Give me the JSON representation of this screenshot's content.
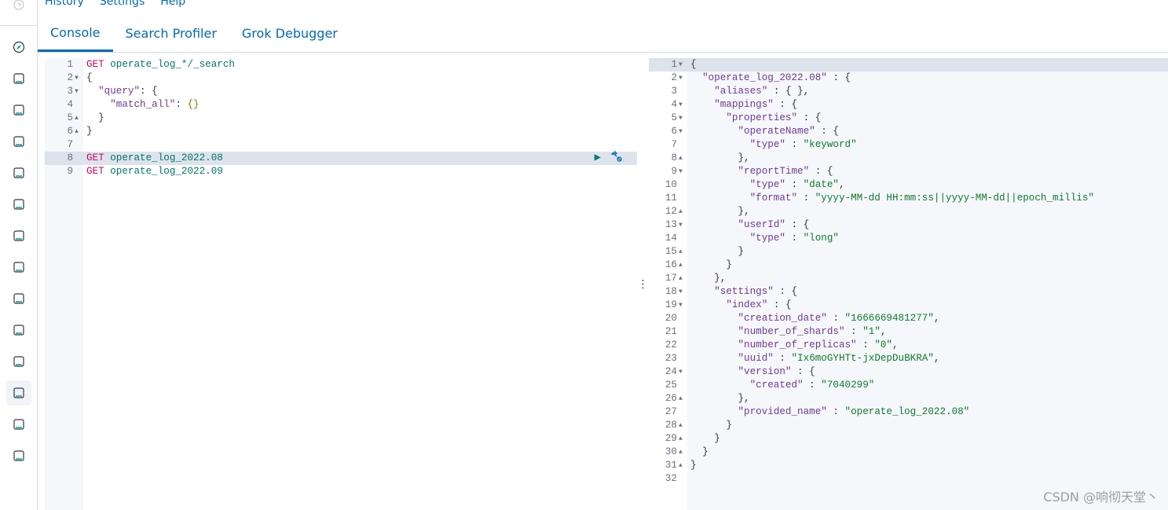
{
  "menu": [
    "History",
    "Settings",
    "Help"
  ],
  "tabs": [
    {
      "label": "Console",
      "active": true
    },
    {
      "label": "Search Profiler"
    },
    {
      "label": "Grok Debugger"
    }
  ],
  "sidebar_icons": [
    "discover-compass-icon",
    "visualize-chart-icon",
    "dashboard-icon",
    "canvas-icon",
    "maps-icon",
    "ml-icon",
    "infrastructure-icon",
    "logs-icon",
    "apm-icon",
    "uptime-icon",
    "security-icon",
    "dev-tools-icon",
    "monitoring-icon",
    "management-gear-icon"
  ],
  "request_editor": {
    "highlighted_line": 8,
    "actions": {
      "run": "▶",
      "wrench": "🔧"
    },
    "lines": [
      {
        "fold": "",
        "tokens": [
          [
            "method",
            "GET"
          ],
          [
            "url",
            " operate_log_*/_search"
          ]
        ]
      },
      {
        "fold": "down",
        "tokens": [
          [
            "punc",
            "{"
          ]
        ]
      },
      {
        "fold": "down",
        "tokens": [
          [
            "punc",
            "  "
          ],
          [
            "key",
            "\"query\""
          ],
          [
            "punc",
            ": {"
          ]
        ]
      },
      {
        "fold": "",
        "tokens": [
          [
            "punc",
            "    "
          ],
          [
            "key",
            "\"match_all\""
          ],
          [
            "punc",
            ": "
          ],
          [
            "brace",
            "{}"
          ]
        ]
      },
      {
        "fold": "up",
        "tokens": [
          [
            "punc",
            "  }"
          ]
        ]
      },
      {
        "fold": "up",
        "tokens": [
          [
            "punc",
            "}"
          ]
        ]
      },
      {
        "fold": "",
        "tokens": []
      },
      {
        "fold": "",
        "tokens": [
          [
            "method",
            "GET"
          ],
          [
            "url",
            " operate_log_2022.08"
          ]
        ]
      },
      {
        "fold": "",
        "tokens": [
          [
            "method",
            "GET"
          ],
          [
            "url",
            " operate_log_2022.09"
          ]
        ]
      }
    ]
  },
  "response_viewer": {
    "highlighted_line": 1,
    "lines": [
      {
        "fold": "down",
        "tokens": [
          [
            "brace",
            "{"
          ]
        ]
      },
      {
        "fold": "down",
        "tokens": [
          [
            "punc",
            "  "
          ],
          [
            "key",
            "\"operate_log_2022.08\""
          ],
          [
            "punc",
            " : {"
          ]
        ]
      },
      {
        "fold": "",
        "tokens": [
          [
            "punc",
            "    "
          ],
          [
            "key",
            "\"aliases\""
          ],
          [
            "punc",
            " : { },"
          ]
        ]
      },
      {
        "fold": "down",
        "tokens": [
          [
            "punc",
            "    "
          ],
          [
            "key",
            "\"mappings\""
          ],
          [
            "punc",
            " : {"
          ]
        ]
      },
      {
        "fold": "down",
        "tokens": [
          [
            "punc",
            "      "
          ],
          [
            "key",
            "\"properties\""
          ],
          [
            "punc",
            " : {"
          ]
        ]
      },
      {
        "fold": "down",
        "tokens": [
          [
            "punc",
            "        "
          ],
          [
            "key",
            "\"operateName\""
          ],
          [
            "punc",
            " : {"
          ]
        ]
      },
      {
        "fold": "",
        "tokens": [
          [
            "punc",
            "          "
          ],
          [
            "key",
            "\"type\""
          ],
          [
            "punc",
            " : "
          ],
          [
            "str",
            "\"keyword\""
          ]
        ]
      },
      {
        "fold": "up",
        "tokens": [
          [
            "punc",
            "        },"
          ]
        ]
      },
      {
        "fold": "down",
        "tokens": [
          [
            "punc",
            "        "
          ],
          [
            "key",
            "\"reportTime\""
          ],
          [
            "punc",
            " : {"
          ]
        ]
      },
      {
        "fold": "",
        "tokens": [
          [
            "punc",
            "          "
          ],
          [
            "key",
            "\"type\""
          ],
          [
            "punc",
            " : "
          ],
          [
            "str",
            "\"date\""
          ],
          [
            "punc",
            ","
          ]
        ]
      },
      {
        "fold": "",
        "tokens": [
          [
            "punc",
            "          "
          ],
          [
            "key",
            "\"format\""
          ],
          [
            "punc",
            " : "
          ],
          [
            "str",
            "\"yyyy-MM-dd HH:mm:ss||yyyy-MM-dd||epoch_millis\""
          ]
        ]
      },
      {
        "fold": "up",
        "tokens": [
          [
            "punc",
            "        },"
          ]
        ]
      },
      {
        "fold": "down",
        "tokens": [
          [
            "punc",
            "        "
          ],
          [
            "key",
            "\"userId\""
          ],
          [
            "punc",
            " : {"
          ]
        ]
      },
      {
        "fold": "",
        "tokens": [
          [
            "punc",
            "          "
          ],
          [
            "key",
            "\"type\""
          ],
          [
            "punc",
            " : "
          ],
          [
            "str",
            "\"long\""
          ]
        ]
      },
      {
        "fold": "up",
        "tokens": [
          [
            "punc",
            "        }"
          ]
        ]
      },
      {
        "fold": "up",
        "tokens": [
          [
            "punc",
            "      }"
          ]
        ]
      },
      {
        "fold": "up",
        "tokens": [
          [
            "punc",
            "    },"
          ]
        ]
      },
      {
        "fold": "down",
        "tokens": [
          [
            "punc",
            "    "
          ],
          [
            "key",
            "\"settings\""
          ],
          [
            "punc",
            " : {"
          ]
        ]
      },
      {
        "fold": "down",
        "tokens": [
          [
            "punc",
            "      "
          ],
          [
            "key",
            "\"index\""
          ],
          [
            "punc",
            " : {"
          ]
        ]
      },
      {
        "fold": "",
        "tokens": [
          [
            "punc",
            "        "
          ],
          [
            "key",
            "\"creation_date\""
          ],
          [
            "punc",
            " : "
          ],
          [
            "str",
            "\"1666669481277\""
          ],
          [
            "punc",
            ","
          ]
        ]
      },
      {
        "fold": "",
        "tokens": [
          [
            "punc",
            "        "
          ],
          [
            "key",
            "\"number_of_shards\""
          ],
          [
            "punc",
            " : "
          ],
          [
            "str",
            "\"1\""
          ],
          [
            "punc",
            ","
          ]
        ]
      },
      {
        "fold": "",
        "tokens": [
          [
            "punc",
            "        "
          ],
          [
            "key",
            "\"number_of_replicas\""
          ],
          [
            "punc",
            " : "
          ],
          [
            "str",
            "\"0\""
          ],
          [
            "punc",
            ","
          ]
        ]
      },
      {
        "fold": "",
        "tokens": [
          [
            "punc",
            "        "
          ],
          [
            "key",
            "\"uuid\""
          ],
          [
            "punc",
            " : "
          ],
          [
            "str",
            "\"Ix6moGYHTt-jxDepDuBKRA\""
          ],
          [
            "punc",
            ","
          ]
        ]
      },
      {
        "fold": "down",
        "tokens": [
          [
            "punc",
            "        "
          ],
          [
            "key",
            "\"version\""
          ],
          [
            "punc",
            " : {"
          ]
        ]
      },
      {
        "fold": "",
        "tokens": [
          [
            "punc",
            "          "
          ],
          [
            "key",
            "\"created\""
          ],
          [
            "punc",
            " : "
          ],
          [
            "str",
            "\"7040299\""
          ]
        ]
      },
      {
        "fold": "up",
        "tokens": [
          [
            "punc",
            "        },"
          ]
        ]
      },
      {
        "fold": "",
        "tokens": [
          [
            "punc",
            "        "
          ],
          [
            "key",
            "\"provided_name\""
          ],
          [
            "punc",
            " : "
          ],
          [
            "str",
            "\"operate_log_2022.08\""
          ]
        ]
      },
      {
        "fold": "up",
        "tokens": [
          [
            "punc",
            "      }"
          ]
        ]
      },
      {
        "fold": "up",
        "tokens": [
          [
            "punc",
            "    }"
          ]
        ]
      },
      {
        "fold": "up",
        "tokens": [
          [
            "punc",
            "  }"
          ]
        ]
      },
      {
        "fold": "up",
        "tokens": [
          [
            "brace",
            "}"
          ]
        ]
      },
      {
        "fold": "",
        "tokens": []
      }
    ]
  },
  "divider_glyph": "⋮",
  "watermark": "CSDN @响彻天堂丶"
}
